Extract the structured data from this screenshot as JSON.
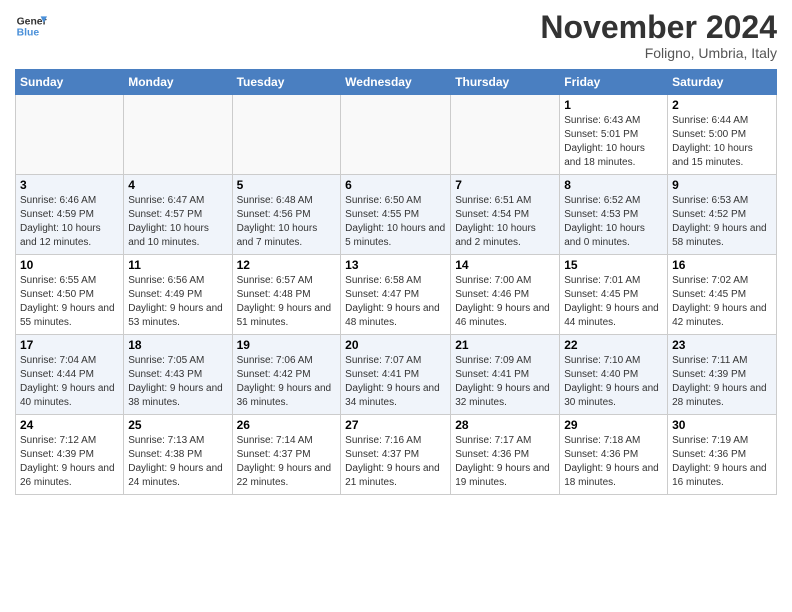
{
  "logo": {
    "line1": "General",
    "line2": "Blue"
  },
  "title": "November 2024",
  "location": "Foligno, Umbria, Italy",
  "days_of_week": [
    "Sunday",
    "Monday",
    "Tuesday",
    "Wednesday",
    "Thursday",
    "Friday",
    "Saturday"
  ],
  "weeks": [
    [
      {
        "day": "",
        "info": ""
      },
      {
        "day": "",
        "info": ""
      },
      {
        "day": "",
        "info": ""
      },
      {
        "day": "",
        "info": ""
      },
      {
        "day": "",
        "info": ""
      },
      {
        "day": "1",
        "info": "Sunrise: 6:43 AM\nSunset: 5:01 PM\nDaylight: 10 hours and 18 minutes."
      },
      {
        "day": "2",
        "info": "Sunrise: 6:44 AM\nSunset: 5:00 PM\nDaylight: 10 hours and 15 minutes."
      }
    ],
    [
      {
        "day": "3",
        "info": "Sunrise: 6:46 AM\nSunset: 4:59 PM\nDaylight: 10 hours and 12 minutes."
      },
      {
        "day": "4",
        "info": "Sunrise: 6:47 AM\nSunset: 4:57 PM\nDaylight: 10 hours and 10 minutes."
      },
      {
        "day": "5",
        "info": "Sunrise: 6:48 AM\nSunset: 4:56 PM\nDaylight: 10 hours and 7 minutes."
      },
      {
        "day": "6",
        "info": "Sunrise: 6:50 AM\nSunset: 4:55 PM\nDaylight: 10 hours and 5 minutes."
      },
      {
        "day": "7",
        "info": "Sunrise: 6:51 AM\nSunset: 4:54 PM\nDaylight: 10 hours and 2 minutes."
      },
      {
        "day": "8",
        "info": "Sunrise: 6:52 AM\nSunset: 4:53 PM\nDaylight: 10 hours and 0 minutes."
      },
      {
        "day": "9",
        "info": "Sunrise: 6:53 AM\nSunset: 4:52 PM\nDaylight: 9 hours and 58 minutes."
      }
    ],
    [
      {
        "day": "10",
        "info": "Sunrise: 6:55 AM\nSunset: 4:50 PM\nDaylight: 9 hours and 55 minutes."
      },
      {
        "day": "11",
        "info": "Sunrise: 6:56 AM\nSunset: 4:49 PM\nDaylight: 9 hours and 53 minutes."
      },
      {
        "day": "12",
        "info": "Sunrise: 6:57 AM\nSunset: 4:48 PM\nDaylight: 9 hours and 51 minutes."
      },
      {
        "day": "13",
        "info": "Sunrise: 6:58 AM\nSunset: 4:47 PM\nDaylight: 9 hours and 48 minutes."
      },
      {
        "day": "14",
        "info": "Sunrise: 7:00 AM\nSunset: 4:46 PM\nDaylight: 9 hours and 46 minutes."
      },
      {
        "day": "15",
        "info": "Sunrise: 7:01 AM\nSunset: 4:45 PM\nDaylight: 9 hours and 44 minutes."
      },
      {
        "day": "16",
        "info": "Sunrise: 7:02 AM\nSunset: 4:45 PM\nDaylight: 9 hours and 42 minutes."
      }
    ],
    [
      {
        "day": "17",
        "info": "Sunrise: 7:04 AM\nSunset: 4:44 PM\nDaylight: 9 hours and 40 minutes."
      },
      {
        "day": "18",
        "info": "Sunrise: 7:05 AM\nSunset: 4:43 PM\nDaylight: 9 hours and 38 minutes."
      },
      {
        "day": "19",
        "info": "Sunrise: 7:06 AM\nSunset: 4:42 PM\nDaylight: 9 hours and 36 minutes."
      },
      {
        "day": "20",
        "info": "Sunrise: 7:07 AM\nSunset: 4:41 PM\nDaylight: 9 hours and 34 minutes."
      },
      {
        "day": "21",
        "info": "Sunrise: 7:09 AM\nSunset: 4:41 PM\nDaylight: 9 hours and 32 minutes."
      },
      {
        "day": "22",
        "info": "Sunrise: 7:10 AM\nSunset: 4:40 PM\nDaylight: 9 hours and 30 minutes."
      },
      {
        "day": "23",
        "info": "Sunrise: 7:11 AM\nSunset: 4:39 PM\nDaylight: 9 hours and 28 minutes."
      }
    ],
    [
      {
        "day": "24",
        "info": "Sunrise: 7:12 AM\nSunset: 4:39 PM\nDaylight: 9 hours and 26 minutes."
      },
      {
        "day": "25",
        "info": "Sunrise: 7:13 AM\nSunset: 4:38 PM\nDaylight: 9 hours and 24 minutes."
      },
      {
        "day": "26",
        "info": "Sunrise: 7:14 AM\nSunset: 4:37 PM\nDaylight: 9 hours and 22 minutes."
      },
      {
        "day": "27",
        "info": "Sunrise: 7:16 AM\nSunset: 4:37 PM\nDaylight: 9 hours and 21 minutes."
      },
      {
        "day": "28",
        "info": "Sunrise: 7:17 AM\nSunset: 4:36 PM\nDaylight: 9 hours and 19 minutes."
      },
      {
        "day": "29",
        "info": "Sunrise: 7:18 AM\nSunset: 4:36 PM\nDaylight: 9 hours and 18 minutes."
      },
      {
        "day": "30",
        "info": "Sunrise: 7:19 AM\nSunset: 4:36 PM\nDaylight: 9 hours and 16 minutes."
      }
    ]
  ]
}
